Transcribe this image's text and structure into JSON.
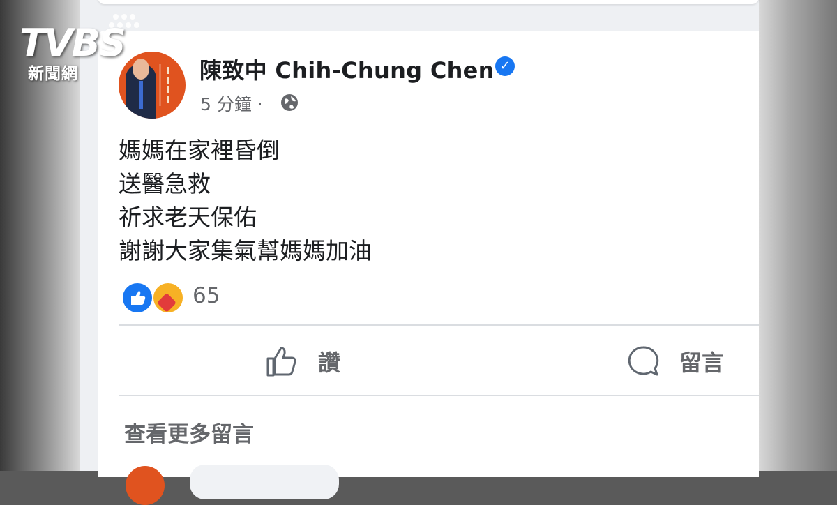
{
  "logo": {
    "brand": "TVBS",
    "subtitle": "新聞網"
  },
  "post": {
    "author": "陳致中 Chih-Chung Chen",
    "verified_icon": "verified-badge-icon",
    "time": "5 分鐘 ·",
    "privacy_icon": "globe-icon",
    "lines": [
      "媽媽在家裡昏倒",
      "送醫急救",
      "祈求老天保佑",
      "謝謝大家集氣幫媽媽加油"
    ],
    "reactions": {
      "icons": [
        "like-icon",
        "care-icon"
      ],
      "count": "65"
    },
    "actions": {
      "like_label": "讚",
      "comment_label": "留言"
    },
    "view_more_comments": "查看更多留言"
  },
  "colors": {
    "accent": "#1877f2",
    "text": "#1c1e21",
    "secondary": "#65676b"
  }
}
